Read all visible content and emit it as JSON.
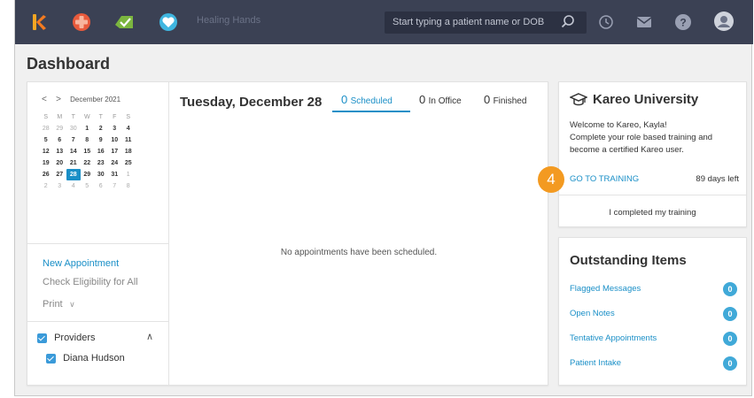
{
  "topbar": {
    "practice_name": "Healing Hands",
    "search_placeholder": "Start typing a patient name or DOB",
    "apps": [
      "kareo-logo-icon",
      "medical-cross-icon",
      "check-tag-icon",
      "heart-icon"
    ],
    "right_icons": [
      "history-icon",
      "mail-icon",
      "help-icon",
      "user-avatar-icon"
    ]
  },
  "page": {
    "title": "Dashboard"
  },
  "calendar": {
    "month_label": "December 2021",
    "prev": "<",
    "next": ">",
    "dow": [
      "S",
      "M",
      "T",
      "W",
      "T",
      "F",
      "S"
    ],
    "weeks": [
      [
        "28",
        "29",
        "30",
        "1",
        "2",
        "3",
        "4"
      ],
      [
        "5",
        "6",
        "7",
        "8",
        "9",
        "10",
        "11"
      ],
      [
        "12",
        "13",
        "14",
        "15",
        "16",
        "17",
        "18"
      ],
      [
        "19",
        "20",
        "21",
        "22",
        "23",
        "24",
        "25"
      ],
      [
        "26",
        "27",
        "28",
        "29",
        "30",
        "31",
        "1"
      ],
      [
        "2",
        "3",
        "4",
        "5",
        "6",
        "7",
        "8"
      ]
    ],
    "today": "28"
  },
  "actions": {
    "new_appointment": "New Appointment",
    "check_eligibility": "Check Eligibility for All",
    "print": "Print"
  },
  "providers": {
    "header": "Providers",
    "items": [
      "Diana Hudson"
    ]
  },
  "schedule": {
    "date": "Tuesday, December 28",
    "tabs": [
      {
        "count": "0",
        "label": "Scheduled"
      },
      {
        "count": "0",
        "label": "In Office"
      },
      {
        "count": "0",
        "label": "Finished"
      }
    ],
    "empty_message": "No appointments have been scheduled."
  },
  "university": {
    "title": "Kareo University",
    "message": "Welcome to Kareo, Kayla! Complete your role based training and become a certified Kareo user.",
    "line1": "Welcome to Kareo, Kayla!",
    "line2": "Complete your role based training and",
    "line3": "become a certified Kareo user.",
    "go_to_training": "GO TO TRAINING",
    "days_left": "89 days left",
    "completed": "I completed my training",
    "step_number": "4"
  },
  "outstanding": {
    "title": "Outstanding Items",
    "items": [
      {
        "label": "Flagged Messages",
        "count": "0"
      },
      {
        "label": "Open Notes",
        "count": "0"
      },
      {
        "label": "Tentative Appointments",
        "count": "0"
      },
      {
        "label": "Patient Intake",
        "count": "0"
      }
    ]
  },
  "colors": {
    "topbar": "#3b4154",
    "accent": "#1a8fc7",
    "badge": "#40a9d8",
    "step": "#f39a21"
  }
}
